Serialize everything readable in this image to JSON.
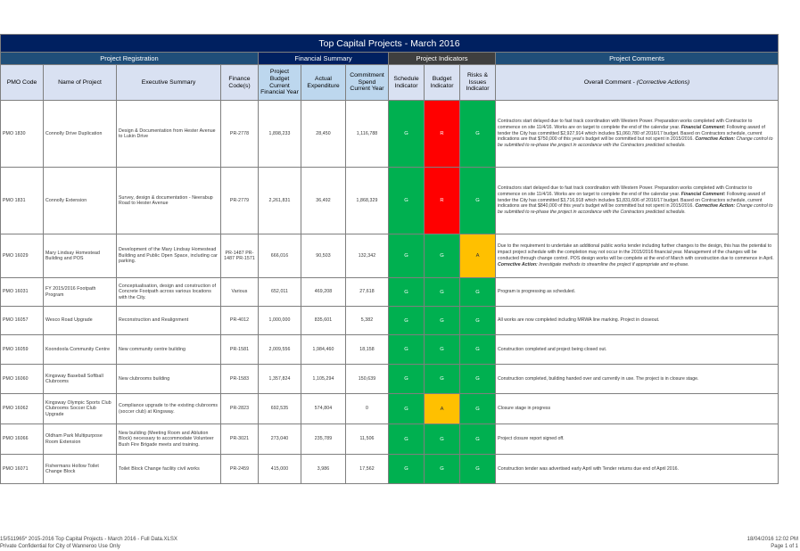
{
  "title": "Top Capital Projects - March 2016",
  "groups": {
    "registration": "Project Registration",
    "financial": "Financial Summary",
    "indicators": "Project Indicators",
    "comments": "Project Comments"
  },
  "columns": {
    "pmo_code": "PMO Code",
    "project_name": "Name of Project",
    "executive_summary": "Executive Summary",
    "finance_codes": "Finance Code(s)",
    "budget": "Project Budget Current Financial Year",
    "actual": "Actual Expenditure",
    "commitment": "Commitment Spend Current Year",
    "schedule": "Schedule Indicator",
    "budget_ind": "Budget Indicator",
    "risks": "Risks & Issues Indicator",
    "comment_main": "Overall Comment - ",
    "comment_italic": "(Corrective Actions)"
  },
  "rows": [
    {
      "code": "PMO 1830",
      "name": "Connolly Drive Duplication",
      "summary": "Design & Documentation from Hester Avenue to Lukin Drive",
      "finance": "PR-2778",
      "budget": "1,898,233",
      "actual": "28,450",
      "commitment": "1,116,788",
      "schedule": "G",
      "budget_ind": "R",
      "risks": "G",
      "comment": "Contractors start delayed due to fast track coordination with Western Power. Preparation works completed with Contractor to commence on site 11/4/16. Works are on target to complete the end of the calendar year.",
      "financial_label": "Financial Comment:",
      "financial": " Following award of tender the City has committed $2,927,914 which includes $1,060,780 of 2016/17 budget. Based on Contractors schedule, current indications are that $750,000 of this year's budget will be committed but not spent in 2015/2016.",
      "corrective_label": "Corrective Action:",
      "corrective": " Change control to be submitted to re-phase the project in accordance with the Contractors predicted schedule."
    },
    {
      "code": "PMO 1831",
      "name": "Connolly Extension",
      "summary": "Survey, design & documentation - Neerabup Road to Hester Avenue",
      "finance": "PR-2779",
      "budget": "2,261,831",
      "actual": "36,492",
      "commitment": "1,868,329",
      "schedule": "G",
      "budget_ind": "R",
      "risks": "G",
      "comment": "Contractors start delayed due to fast track coordination with Western Power. Preparation works completed with Contractor to commence on site 11/4/16. Works are on target to complete the end of the calendar year.",
      "financial_label": "Financial Comment:",
      "financial": " Following award of tender the City has committed $3,716,918 which includes $1,831,606 of 2016/17 budget. Based on Contractors schedule, current indications are that $840,000 of this year's budget will be committed but not spent in 2015/2016.",
      "corrective_label": "Corrective Action:",
      "corrective": " Change control to be submitted to re-phase the project in accordance with the Contractors predicted schedule."
    },
    {
      "code": "PMO 16029",
      "name": "Mary Lindsay Homestead Building and POS",
      "summary": "Development of the Mary Lindsay Homestead Building and Public Open Space, including car parking.",
      "finance": "PR-1487 PR-1487 PR-1571",
      "budget": "666,016",
      "actual": "90,503",
      "commitment": "132,342",
      "schedule": "G",
      "budget_ind": "G",
      "risks": "A",
      "comment": "Due to the requirement to undertake an additional public works tender including further changes to the design, this has the potential to impact project schedule with the completion may not occur in the 2015/2016 financial year. Management of the changes will be conducted through change control. POS design works will be complete at the end of March with construction due to commence in April.",
      "financial_label": "",
      "financial": "",
      "corrective_label": "Corrective Action:",
      "corrective": " Investigate methods to streamline the project if appropriate and re-phase."
    },
    {
      "code": "PMO 16031",
      "name": "FY 2015/2016 Footpath Program",
      "summary": "Conceptualisation, design and construction of Concrete Footpath across various locations with the City.",
      "finance": "Various",
      "budget": "652,011",
      "actual": "469,208",
      "commitment": "27,618",
      "schedule": "G",
      "budget_ind": "G",
      "risks": "G",
      "comment": "Program is progressing as scheduled.",
      "financial_label": "",
      "financial": "",
      "corrective_label": "",
      "corrective": ""
    },
    {
      "code": "PMO 16057",
      "name": "Wesco Road Upgrade",
      "summary": "Reconstruction and Realignment",
      "finance": "PR-4012",
      "budget": "1,000,000",
      "actual": "835,601",
      "commitment": "5,382",
      "schedule": "G",
      "budget_ind": "G",
      "risks": "G",
      "comment": "All works are now completed including MRWA line marking. Project in closeout.",
      "financial_label": "",
      "financial": "",
      "corrective_label": "",
      "corrective": ""
    },
    {
      "code": "PMO 16059",
      "name": "Koondoola Community Centre",
      "summary": "New community centre building",
      "finance": "PR-1581",
      "budget": "2,009,556",
      "actual": "1,984,460",
      "commitment": "18,158",
      "schedule": "G",
      "budget_ind": "G",
      "risks": "G",
      "comment": "Construction completed and project being closed out.",
      "financial_label": "",
      "financial": "",
      "corrective_label": "",
      "corrective": ""
    },
    {
      "code": "PMO 16060",
      "name": "Kingsway Baseball Softball Clubrooms",
      "summary": "New clubrooms building",
      "finance": "PR-1583",
      "budget": "1,357,824",
      "actual": "1,105,294",
      "commitment": "150,639",
      "schedule": "G",
      "budget_ind": "G",
      "risks": "G",
      "comment": "Construction completed, building handed over and currently in use. The project is in closure stage.",
      "financial_label": "",
      "financial": "",
      "corrective_label": "",
      "corrective": ""
    },
    {
      "code": "PMO 16062",
      "name": "Kingsway Olympic Sports Club Clubrooms Soccer Club Upgrade",
      "summary": "Compliance upgrade to the existing clubrooms (soccer club) at Kingsway.",
      "finance": "PR-2823",
      "budget": "692,535",
      "actual": "574,804",
      "commitment": "0",
      "schedule": "G",
      "budget_ind": "A",
      "risks": "G",
      "comment": "Closure stage in progress",
      "financial_label": "",
      "financial": "",
      "corrective_label": "",
      "corrective": ""
    },
    {
      "code": "PMO 16066",
      "name": "Oldham Park Multipurpose Room Extension",
      "summary": "New building (Meeting Room and Ablution Block) necessary to accommodate Volunteer Bush Fire Brigade meets and training.",
      "finance": "PR-3021",
      "budget": "273,040",
      "actual": "235,789",
      "commitment": "11,506",
      "schedule": "G",
      "budget_ind": "G",
      "risks": "G",
      "comment": "Project closure report signed off.",
      "financial_label": "",
      "financial": "",
      "corrective_label": "",
      "corrective": ""
    },
    {
      "code": "PMO 16071",
      "name": "Fishermans Hollow Toilet Change Block",
      "summary": "Toilet Block Change facility civil works",
      "finance": "PR-2459",
      "budget": "415,000",
      "actual": "3,986",
      "commitment": "17,562",
      "schedule": "G",
      "budget_ind": "G",
      "risks": "G",
      "comment": "Construction tender was advertised early April with Tender returns due end of April 2016.",
      "financial_label": "",
      "financial": "",
      "corrective_label": "",
      "corrective": ""
    }
  ],
  "footer": {
    "left_line1": "15/511965* 2015-2016 Top Capital Projects - March 2016 - Full Data.XLSX",
    "left_line2": "Private Confidential for City of Wanneroo Use Only",
    "right_line1": "18/04/2016 12:02 PM",
    "right_line2": "Page 1 of 1"
  }
}
